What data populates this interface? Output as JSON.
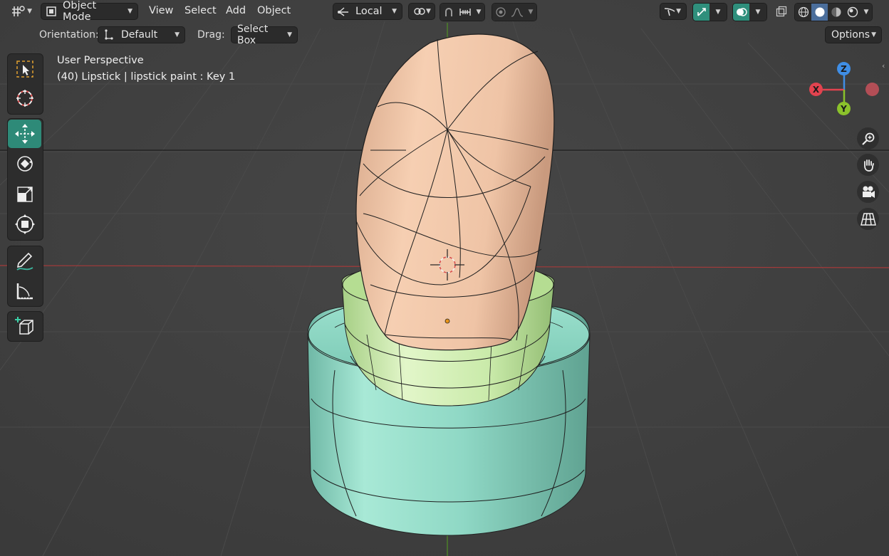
{
  "header": {
    "editor_type_icon": "editor-type-icon",
    "mode": "Object Mode",
    "menus": [
      "View",
      "Select",
      "Add",
      "Object"
    ],
    "transform_orientation": "Local",
    "options_label": "Options"
  },
  "tool_settings": {
    "orientation_label": "Orientation:",
    "orientation_value": "Default",
    "drag_label": "Drag:",
    "drag_value": "Select Box"
  },
  "viewport": {
    "view_name": "User Perspective",
    "object_info": "(40) Lipstick | lipstick paint : Key 1"
  },
  "toolbar": {
    "tools": [
      "select-box-icon",
      "cursor-icon",
      "move-icon",
      "rotate-icon",
      "scale-icon",
      "transform-icon",
      "annotate-icon",
      "measure-icon",
      "add-cube-icon"
    ],
    "active_tool": "move-icon"
  },
  "gizmo": {
    "axes": {
      "x": "X",
      "y": "Y",
      "z": "Z"
    },
    "colors": {
      "x": "#e2434f",
      "y": "#8bc22b",
      "z": "#3f8ee6",
      "neg_x": "#c8515a"
    }
  },
  "navigation": [
    "zoom-icon",
    "hand-pan-icon",
    "camera-icon",
    "grid-ortho-icon"
  ],
  "colors": {
    "background": "#3d3d3d",
    "accent": "#2e8a78",
    "lipstick": "#efc4a4",
    "ring": "#c3e7a2",
    "base": "#8ed9c4",
    "x_axis_line": "#b43a3a",
    "y_axis_line": "#5a9a2a"
  }
}
